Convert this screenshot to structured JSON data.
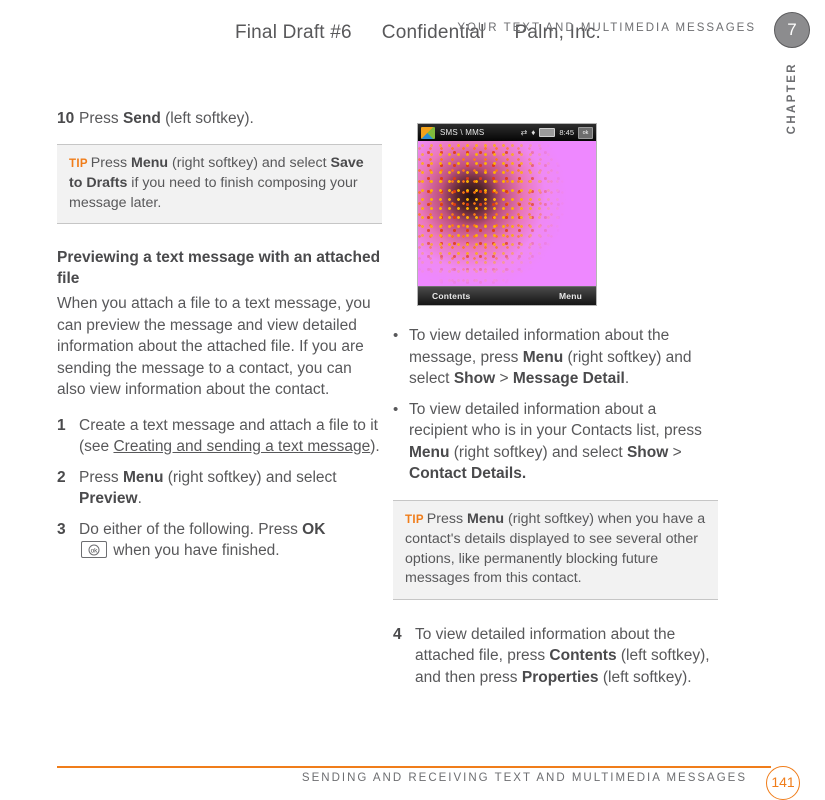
{
  "draft_header": {
    "part1": "Final Draft #6",
    "part2": "Confidential",
    "part3": "Palm, Inc."
  },
  "running_head": "YOUR TEXT AND MULTIMEDIA MESSAGES",
  "chapter_tab": {
    "number": "7",
    "label": "CHAPTER"
  },
  "left_column": {
    "step10": {
      "num": "10",
      "text_pre": "Press ",
      "bold1": "Send",
      "text_post": " (left softkey)."
    },
    "tip1": {
      "label": "TIP",
      "t1": "Press ",
      "b1": "Menu",
      "t2": " (right softkey) and select ",
      "b2": "Save to Drafts",
      "t3": " if you need to finish composing your message later."
    },
    "subhead": "Previewing a text message with an attached file",
    "intro": "When you attach a file to a text message, you can preview the message and view detailed information about the attached file. If you are sending the message to a contact, you can also view information about the contact.",
    "step1": {
      "num": "1",
      "t1": "Create a text message and attach a file to it (see ",
      "xref": "Creating and sending a text message",
      "t2": ")."
    },
    "step2": {
      "num": "2",
      "t1": "Press ",
      "b1": "Menu",
      "t2": " (right softkey) and select ",
      "b2": "Preview",
      "t3": "."
    },
    "step3": {
      "num": "3",
      "t1": "Do either of the following. Press ",
      "b1": "OK",
      "key_icon": "ok-key",
      "t2": " when you have finished."
    }
  },
  "right_column": {
    "phone_screenshot": {
      "title": "SMS \\ MMS",
      "clock": "8:45",
      "ok_badge": "ok",
      "left_softkey": "Contents",
      "right_softkey": "Menu",
      "icons": [
        "connectivity-icon",
        "signal-icon",
        "battery-icon"
      ]
    },
    "bullets": [
      {
        "dot": "•",
        "t1": "To view detailed information about the message, press ",
        "b1": "Menu",
        "t2": " (right softkey) and select ",
        "b2": "Show",
        "t3": " > ",
        "b3": "Message Detail",
        "t4": "."
      },
      {
        "dot": "•",
        "t1": "To view detailed information about a recipient who is in your Contacts list, press ",
        "b1": "Menu",
        "t2": " (right softkey) and select ",
        "b2": "Show",
        "t3": " > ",
        "b3": "Contact Details.",
        "t4": ""
      }
    ],
    "tip2": {
      "label": "TIP",
      "t1": "Press ",
      "b1": "Menu",
      "t2": " (right softkey) when you have a contact's details displayed to see several other options, like permanently blocking future messages from this contact."
    },
    "step4": {
      "num": "4",
      "t1": "To view detailed information about the attached file, press ",
      "b1": "Contents",
      "t2": " (left softkey), and then press ",
      "b2": "Properties",
      "t3": " (left softkey)."
    }
  },
  "footer": {
    "text": "SENDING AND RECEIVING TEXT AND MULTIMEDIA MESSAGES",
    "page_number": "141"
  },
  "colors": {
    "accent_orange": "#f07d1a",
    "body_gray": "#58585a",
    "tip_background": "#f2f2f2",
    "tip_rule": "#c6c6c6",
    "chapter_circle": "#8c8c8e"
  }
}
